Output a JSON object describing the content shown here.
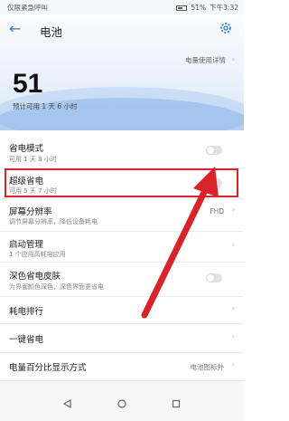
{
  "status": {
    "left": "仅限紧急呼叫",
    "battery": "51%",
    "time": "下午3:32"
  },
  "header": {
    "title": "电池"
  },
  "usage_link": "电量使用详情",
  "battery_level": "51",
  "remaining": "预计可用 1 天 6 小时",
  "rows": [
    {
      "label": "省电模式",
      "sub": "可用 1 天 8 小时",
      "toggle": false
    },
    {
      "label": "超级省电",
      "sub": "可用 5 天 7 小时",
      "toggle": false
    },
    {
      "label": "屏幕分辨率",
      "sub": "调节屏幕分辨率，降低设备耗电",
      "value": "FHD"
    },
    {
      "label": "启动管理",
      "sub": "1 个应用高耗电应用"
    },
    {
      "label": "深色省电皮肤",
      "sub": "为界面颜色深色，深色界面更省电",
      "toggle": false
    },
    {
      "label": "耗电排行"
    },
    {
      "label": "一键省电"
    },
    {
      "label": "电量百分比显示方式",
      "value": "电池图标外"
    }
  ],
  "colors": {
    "accent": "#2d7ad6",
    "highlight": "#d8232a"
  }
}
